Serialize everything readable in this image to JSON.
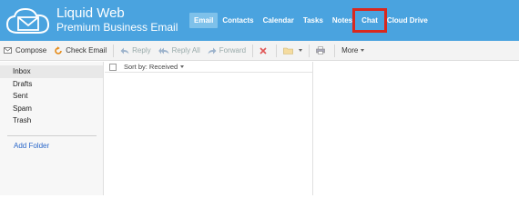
{
  "brand": {
    "name": "Liquid Web",
    "subtitle": "Premium Business Email",
    "bar_color": "#4aa3df"
  },
  "nav": {
    "items": [
      {
        "label": "Email",
        "active": true
      },
      {
        "label": "Contacts"
      },
      {
        "label": "Calendar"
      },
      {
        "label": "Tasks"
      },
      {
        "label": "Notes"
      },
      {
        "label": "Chat",
        "highlighted": true
      },
      {
        "label": "Cloud Drive"
      }
    ],
    "highlight_color": "#d9281e"
  },
  "toolbar": {
    "compose": "Compose",
    "check_email": "Check Email",
    "reply": "Reply",
    "reply_all": "Reply All",
    "forward": "Forward",
    "more": "More"
  },
  "sidebar": {
    "folders": [
      "Inbox",
      "Drafts",
      "Sent",
      "Spam",
      "Trash"
    ],
    "selected": "Inbox",
    "add_folder": "Add Folder"
  },
  "message_list": {
    "sort_label": "Sort by: Received"
  },
  "icons": [
    "envelope-logo-icon",
    "compose-icon",
    "refresh-icon",
    "reply-icon",
    "reply-all-icon",
    "forward-icon",
    "delete-icon",
    "folder-icon",
    "print-icon"
  ]
}
